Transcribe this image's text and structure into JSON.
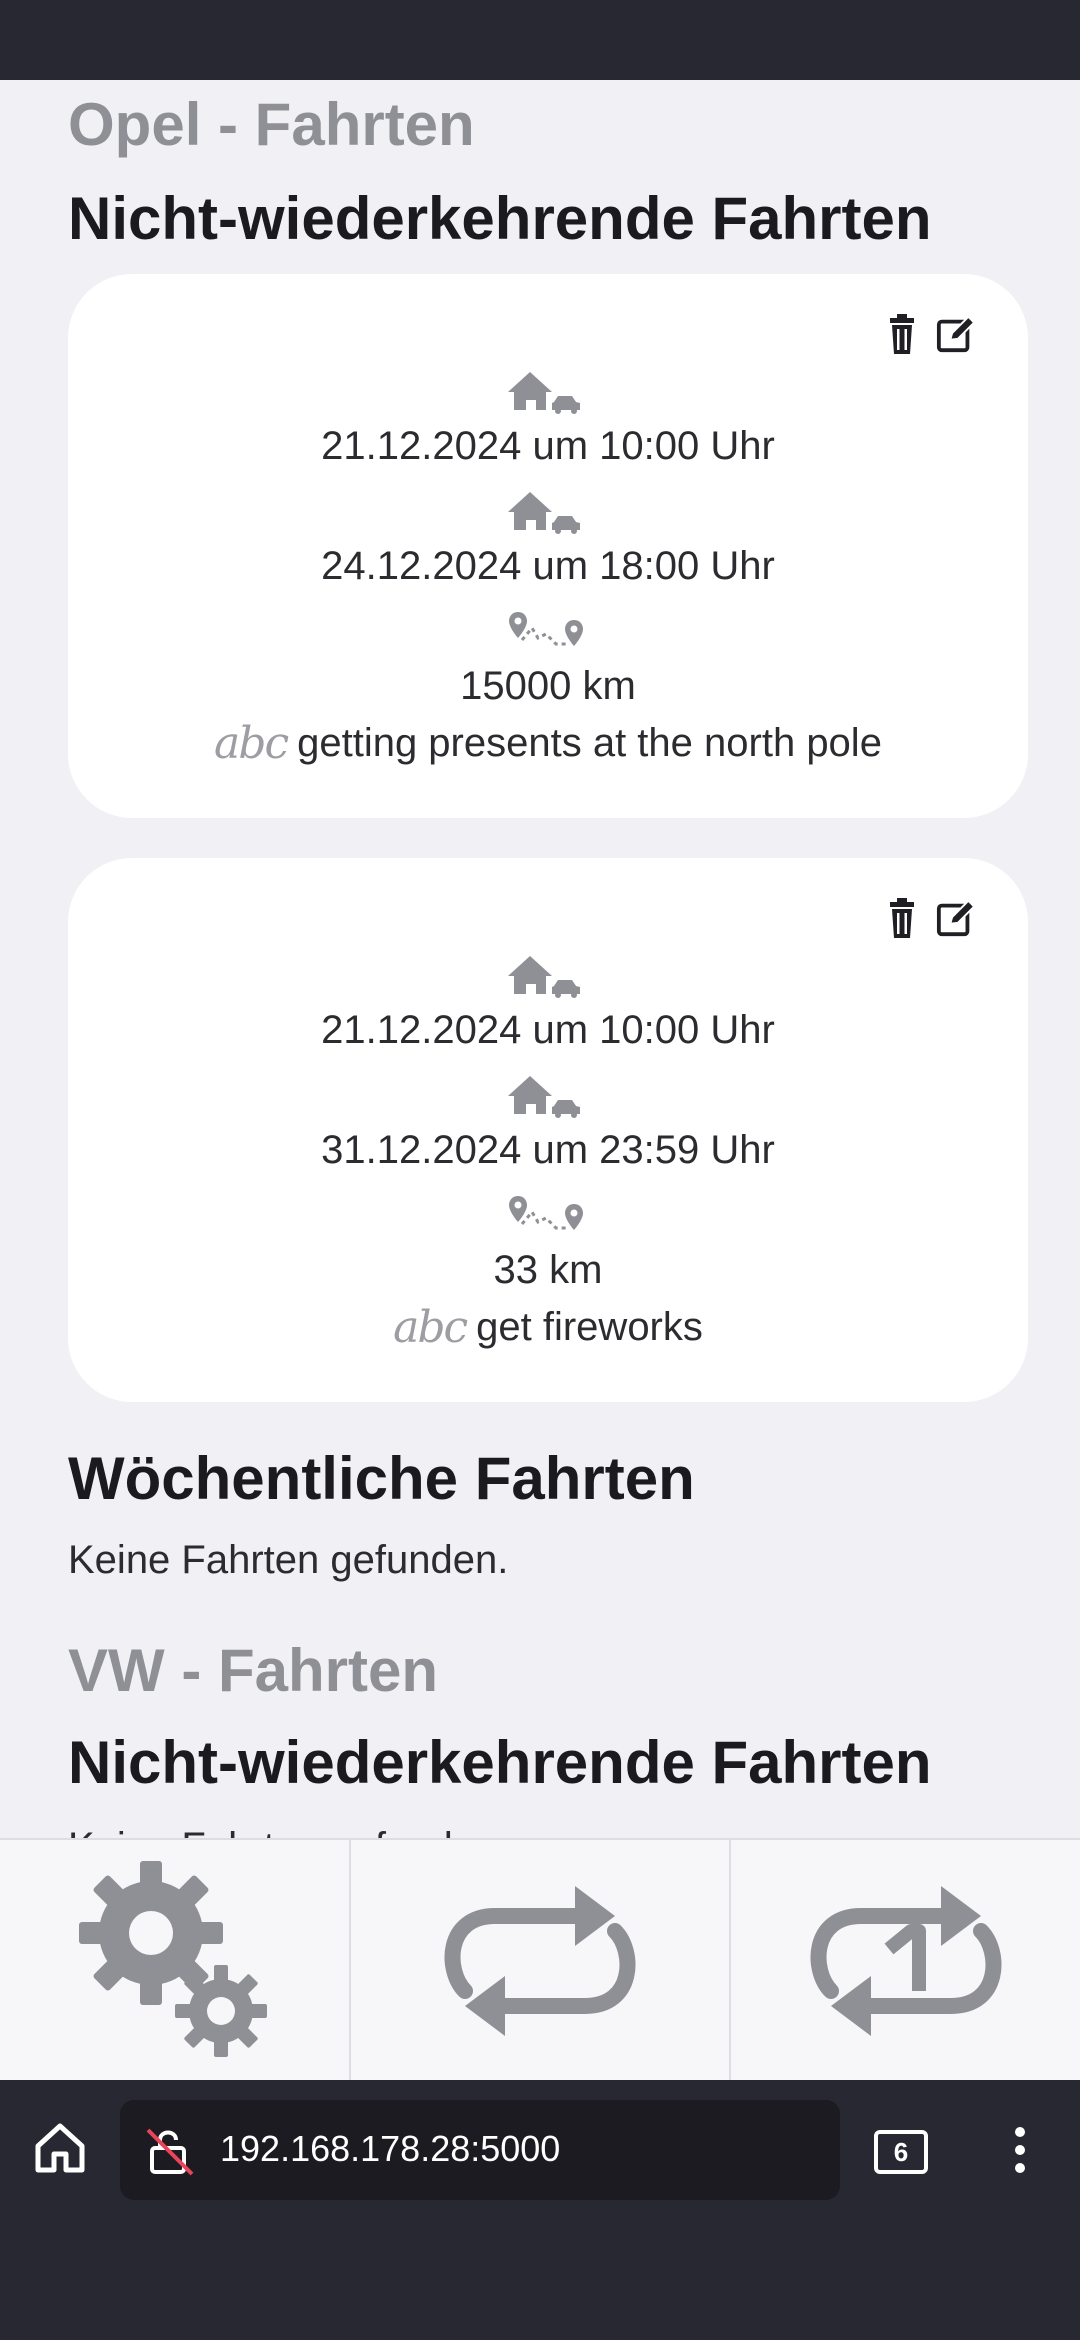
{
  "vehicles": [
    {
      "title": "Opel - Fahrten",
      "one_time_heading": "Nicht-wiederkehrende Fahrten",
      "trips": [
        {
          "start": "21.12.2024 um 10:00 Uhr",
          "end": "24.12.2024 um 18:00 Uhr",
          "distance": "15000 km",
          "note": "getting presents at the north pole"
        },
        {
          "start": "21.12.2024 um 10:00 Uhr",
          "end": "31.12.2024 um 23:59 Uhr",
          "distance": "33 km",
          "note": "get fireworks"
        }
      ],
      "weekly_heading": "Wöchentliche Fahrten",
      "weekly_empty": "Keine Fahrten gefunden."
    },
    {
      "title": "VW - Fahrten",
      "one_time_heading": "Nicht-wiederkehrende Fahrten",
      "one_time_empty": "Keine Fahrten gefunden."
    }
  ],
  "note_icon_text": "abc",
  "bottom_nav": {
    "items": [
      "settings-icon",
      "repeat-icon",
      "repeat-once-icon"
    ]
  },
  "browser": {
    "url": "192.168.178.28:5000",
    "tab_count": "6"
  },
  "colors": {
    "icon_gray": "#8f8f96",
    "card_bg": "#ffffff",
    "page_bg": "#f1f0f5",
    "chrome_bg": "#282832"
  }
}
